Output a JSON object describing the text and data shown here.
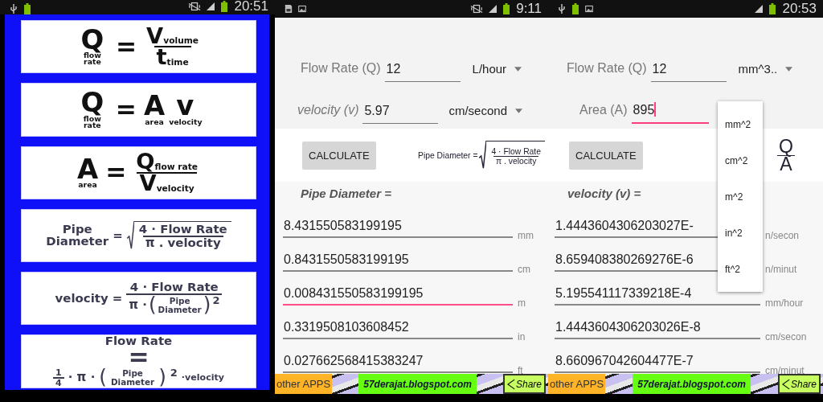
{
  "screens": [
    {
      "kind": "formulas",
      "status_bar": {
        "left_icons": [
          {
            "kind": "usb"
          },
          {
            "kind": "battery"
          }
        ],
        "right_icons": [
          {
            "kind": "muted"
          },
          {
            "kind": "signal"
          },
          {
            "kind": "battery"
          }
        ],
        "time": "20:51"
      },
      "formulas": [
        {
          "rows": [
            [
              {
                "kind": "var",
                "text": "Q",
                "sub": "flow rate"
              },
              {
                "kind": "op",
                "text": "="
              },
              {
                "kind": "frac",
                "num": [
                  {
                    "kind": "var_r",
                    "text": "V",
                    "sub": "volume"
                  }
                ],
                "den": [
                  {
                    "kind": "var_r",
                    "text": "t",
                    "sub": "time"
                  }
                ]
              }
            ]
          ]
        },
        {
          "rows": [
            [
              {
                "kind": "var",
                "text": "Q",
                "sub": "flow rate"
              },
              {
                "kind": "op",
                "text": "="
              },
              {
                "kind": "var",
                "text": "A",
                "sub": "area"
              },
              {
                "kind": "var",
                "text": "v",
                "sub": "velocity"
              }
            ]
          ]
        },
        {
          "rows": [
            [
              {
                "kind": "var",
                "text": "A",
                "sub": "area"
              },
              {
                "kind": "op",
                "text": "="
              },
              {
                "kind": "frac",
                "num": [
                  {
                    "kind": "var_r",
                    "text": "Q",
                    "sub": "flow rate"
                  }
                ],
                "den": [
                  {
                    "kind": "var_r",
                    "text": "V",
                    "sub": "velocity"
                  }
                ]
              }
            ]
          ]
        },
        {
          "rows": [
            [
              {
                "kind": "stack",
                "top": "Pipe",
                "bottom": "Diameter"
              },
              {
                "kind": "word",
                "text": "="
              },
              {
                "kind": "sqrt",
                "body": [
                  {
                    "kind": "frac",
                    "num": [
                      {
                        "kind": "word",
                        "text": "4 · Flow Rate"
                      }
                    ],
                    "den": [
                      {
                        "kind": "word",
                        "text": "π . velocity"
                      }
                    ]
                  }
                ]
              }
            ]
          ]
        },
        {
          "rows": [
            [
              {
                "kind": "word",
                "text": "velocity"
              },
              {
                "kind": "word",
                "text": "="
              },
              {
                "kind": "frac",
                "num": [
                  {
                    "kind": "word",
                    "text": "4 · Flow Rate"
                  }
                ],
                "den": [
                  {
                    "kind": "word",
                    "text": "π ·"
                  },
                  {
                    "kind": "paren",
                    "text": "("
                  },
                  {
                    "kind": "stack",
                    "top": "Pipe",
                    "bottom": "Diameter"
                  },
                  {
                    "kind": "paren",
                    "text": ")"
                  },
                  {
                    "kind": "sup",
                    "text": "2"
                  }
                ]
              }
            ]
          ]
        },
        {
          "rows": [
            [
              {
                "kind": "word",
                "text": "Flow Rate"
              }
            ],
            [
              {
                "kind": "op",
                "text": "="
              }
            ],
            [
              {
                "kind": "frac",
                "num": [
                  {
                    "kind": "small",
                    "text": "1"
                  }
                ],
                "den": [
                  {
                    "kind": "small",
                    "text": "4"
                  }
                ]
              },
              {
                "kind": "word",
                "text": "· π ·"
              },
              {
                "kind": "paren",
                "text": "("
              },
              {
                "kind": "stack",
                "top": "Pipe",
                "bottom": "Diameter"
              },
              {
                "kind": "paren",
                "text": ")"
              },
              {
                "kind": "sup",
                "text": "2"
              },
              {
                "kind": "small",
                "text": "·velocity"
              }
            ]
          ]
        }
      ]
    },
    {
      "kind": "calculator",
      "status_bar": {
        "left_icons": [
          {
            "kind": "sd"
          },
          {
            "kind": "image"
          }
        ],
        "right_icons": [
          {
            "kind": "muted"
          },
          {
            "kind": "signal"
          },
          {
            "kind": "battery"
          }
        ],
        "time": "9:11"
      },
      "inputs": [
        {
          "label": "Flow Rate (Q)",
          "italic": false,
          "value": "12",
          "focused": false,
          "unit": "L/hour"
        },
        {
          "label": "velocity (v)",
          "italic": true,
          "value": "5.97",
          "focused": false,
          "unit": "cm/second"
        }
      ],
      "button": "CALCULATE",
      "formula": [
        {
          "kind": "word",
          "text": "Pipe Diameter ="
        },
        {
          "kind": "sqrt",
          "body": [
            {
              "kind": "frac",
              "num": [
                {
                  "kind": "word",
                  "text": "4 · Flow Rate"
                }
              ],
              "den": [
                {
                  "kind": "word",
                  "text": "π . velocity"
                }
              ]
            }
          ]
        }
      ],
      "result_heading": "Pipe Diameter =",
      "results": [
        {
          "value": "8.431550583199195",
          "unit": "mm",
          "focused": false
        },
        {
          "value": "0.8431550583199195",
          "unit": "cm",
          "focused": false
        },
        {
          "value": "0.008431550583199195",
          "unit": "m",
          "focused": true
        },
        {
          "value": "0.3319508103608452",
          "unit": "in",
          "focused": false
        },
        {
          "value": "0.027662568415383247",
          "unit": "ft",
          "focused": false
        }
      ],
      "footer": {
        "apps": "other APPS",
        "site": "57derajat.blogspot.com",
        "share": "Share"
      }
    },
    {
      "kind": "calculator",
      "status_bar": {
        "left_icons": [
          {
            "kind": "usb"
          },
          {
            "kind": "battery"
          },
          {
            "kind": "image"
          }
        ],
        "right_icons": [
          {
            "kind": "signal"
          },
          {
            "kind": "battery"
          }
        ],
        "time": "20:53"
      },
      "inputs": [
        {
          "label": "Flow Rate (Q)",
          "italic": false,
          "value": "12",
          "focused": false,
          "unit": "mm^3.."
        },
        {
          "label": "Area (A)",
          "italic": false,
          "value": "895",
          "focused": true
        }
      ],
      "button": "CALCULATE",
      "formula": [
        {
          "kind": "frac",
          "num": [
            {
              "kind": "var",
              "text": "Q"
            }
          ],
          "den": [
            {
              "kind": "var",
              "text": "A"
            }
          ]
        }
      ],
      "result_heading": "velocity (v) =",
      "results": [
        {
          "value": "1.4443604306203027E-",
          "unit": "n/secon",
          "focused": false
        },
        {
          "value": "8.659408380269276E-6",
          "unit": "n/minut",
          "focused": false
        },
        {
          "value": "5.195541117339218E-4",
          "unit": "mm/hour",
          "focused": false
        },
        {
          "value": "1.4443604306203026E-8",
          "unit": "cm/secon",
          "focused": false
        },
        {
          "value": "8.660967042604477E-7",
          "unit": "cm/minut",
          "focused": false
        }
      ],
      "menu": [
        "mm^2",
        "cm^2",
        "m^2",
        "in^2",
        "ft^2"
      ],
      "footer": {
        "apps": "other APPS",
        "site": "57derajat.blogspot.com",
        "share": "Share"
      }
    }
  ]
}
